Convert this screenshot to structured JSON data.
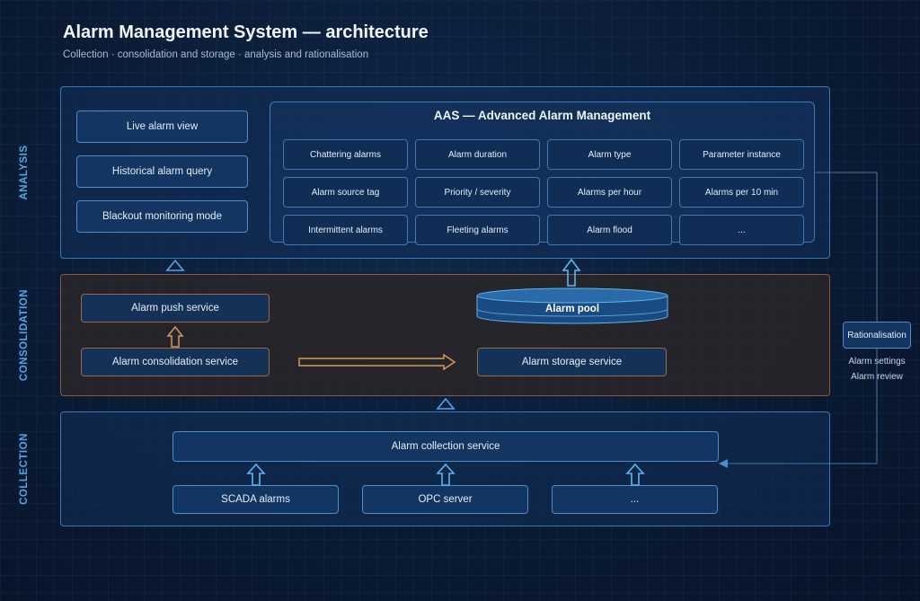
{
  "header": {
    "title": "Alarm Management System — architecture",
    "subtitle": "Collection · consolidation and storage · analysis and rationalisation"
  },
  "layers": {
    "analysis": "ANALYSIS",
    "consolidation": "CONSOLIDATION",
    "collection": "COLLECTION"
  },
  "analysis": {
    "views": [
      "Live alarm view",
      "Historical alarm query",
      "Blackout monitoring mode"
    ],
    "aas": {
      "title": "AAS — Advanced Alarm Management",
      "metrics": [
        "Chattering alarms",
        "Alarm duration",
        "Alarm type",
        "Parameter instance",
        "Alarm source tag",
        "Priority / severity",
        "Alarms per hour",
        "Alarms per 10 min",
        "Intermittent alarms",
        "Fleeting alarms",
        "Alarm flood",
        "..."
      ]
    }
  },
  "consolidation": {
    "push": "Alarm push service",
    "consolidation_service": "Alarm consolidation service",
    "pool": "Alarm pool",
    "storage": "Alarm storage service"
  },
  "collection": {
    "service": "Alarm collection service",
    "sources": [
      "SCADA alarms",
      "OPC server",
      "..."
    ]
  },
  "rationalisation": {
    "label": "Rationalisation",
    "settings": "Alarm settings",
    "review": "Alarm review"
  },
  "colors": {
    "accent_blue": "#4fa6e8",
    "consolidation_border": "#8a5a3a",
    "orange_arrow": "#d89a5a"
  }
}
